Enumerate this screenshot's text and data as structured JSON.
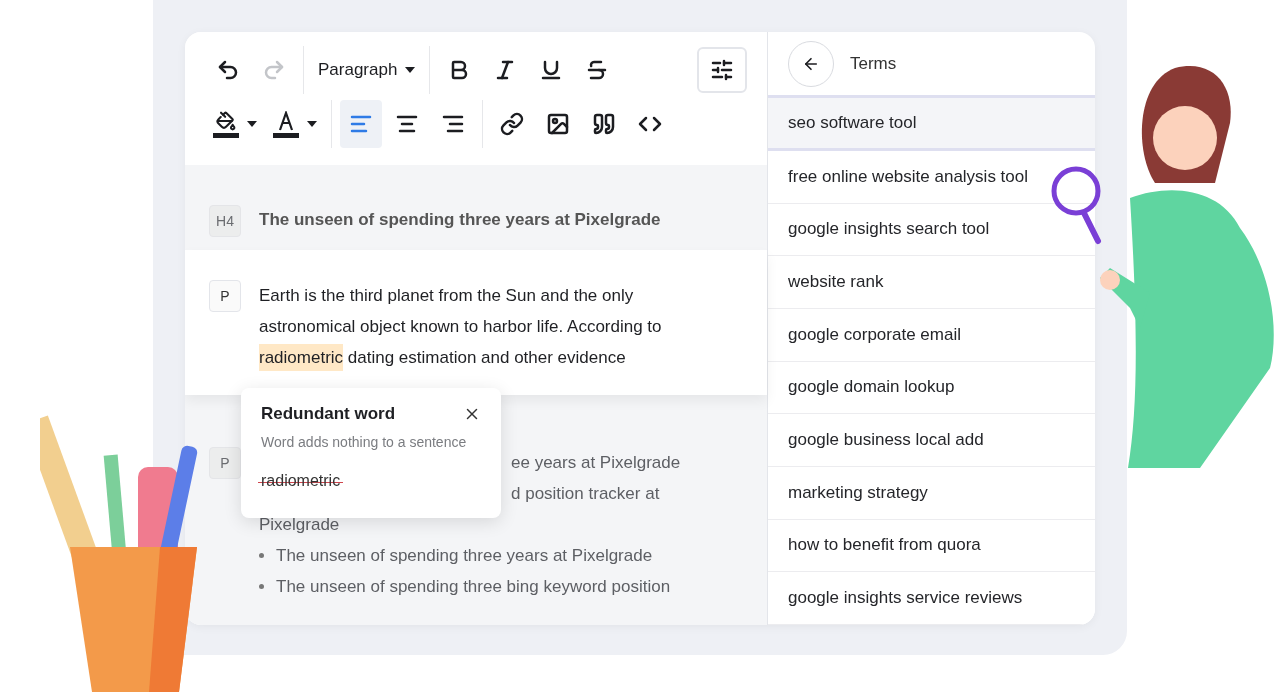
{
  "toolbar": {
    "rows": [
      [
        [
          {
            "kind": "undo",
            "disabled": false
          },
          {
            "kind": "redo",
            "disabled": true
          }
        ],
        [
          {
            "kind": "format",
            "label": "Paragraph"
          }
        ],
        [
          {
            "kind": "bold"
          },
          {
            "kind": "italic"
          },
          {
            "kind": "underline"
          },
          {
            "kind": "strikethrough"
          }
        ]
      ],
      [
        [
          {
            "kind": "fill-color"
          },
          {
            "kind": "text-color"
          }
        ],
        [
          {
            "kind": "align-left",
            "selected": true
          },
          {
            "kind": "align-center",
            "selected": false
          },
          {
            "kind": "align-right",
            "selected": false
          }
        ],
        [
          {
            "kind": "link"
          },
          {
            "kind": "image"
          },
          {
            "kind": "quote"
          },
          {
            "kind": "code"
          }
        ]
      ]
    ],
    "settings_button": {
      "kind": "settings"
    }
  },
  "blocks": [
    {
      "kind": "heading",
      "tag": "H4",
      "blurred": true,
      "lines": [
        {
          "text": "The unseen of spending three years at Pixelgrade"
        }
      ]
    },
    {
      "kind": "paragraph",
      "tag": "P",
      "blurred": false,
      "segments": [
        {
          "text": "Earth is the third planet from the Sun and the only astronomical object known to harbor life. According to ",
          "highlighted": false
        },
        {
          "text": "radiometric",
          "highlighted": true
        },
        {
          "text": " dating estimation and other evidence",
          "highlighted": false
        }
      ]
    },
    {
      "kind": "list",
      "tag": "P",
      "blurred": true,
      "lines": [
        {
          "text": "ee years at Pixelgrade",
          "covered": true,
          "bullet": false
        },
        {
          "text": "d position tracker at",
          "covered": true,
          "bullet": false
        },
        {
          "text": "Pixelgrade",
          "covered": false,
          "bullet": false
        },
        {
          "text": "The unseen of spending three years at Pixelgrade",
          "covered": false,
          "bullet": true
        },
        {
          "text": "The unseen of spending three bing keyword position",
          "covered": false,
          "bullet": true
        }
      ]
    }
  ],
  "popup": {
    "title": "Redundant word",
    "description": "Word adds nothing to a sentence",
    "suggestion": "radiometric"
  },
  "terms": {
    "title": "Terms",
    "items": [
      {
        "label": "seo software tool",
        "selected": true
      },
      {
        "label": "free online website analysis tool",
        "selected": false
      },
      {
        "label": "google insights search tool",
        "selected": false
      },
      {
        "label": "website rank",
        "selected": false
      },
      {
        "label": "google corporate email",
        "selected": false
      },
      {
        "label": "google domain lookup",
        "selected": false
      },
      {
        "label": "google business local add",
        "selected": false
      },
      {
        "label": "marketing strategy",
        "selected": false
      },
      {
        "label": "how to benefit from quora",
        "selected": false
      },
      {
        "label": "google insights service reviews",
        "selected": false
      }
    ]
  }
}
